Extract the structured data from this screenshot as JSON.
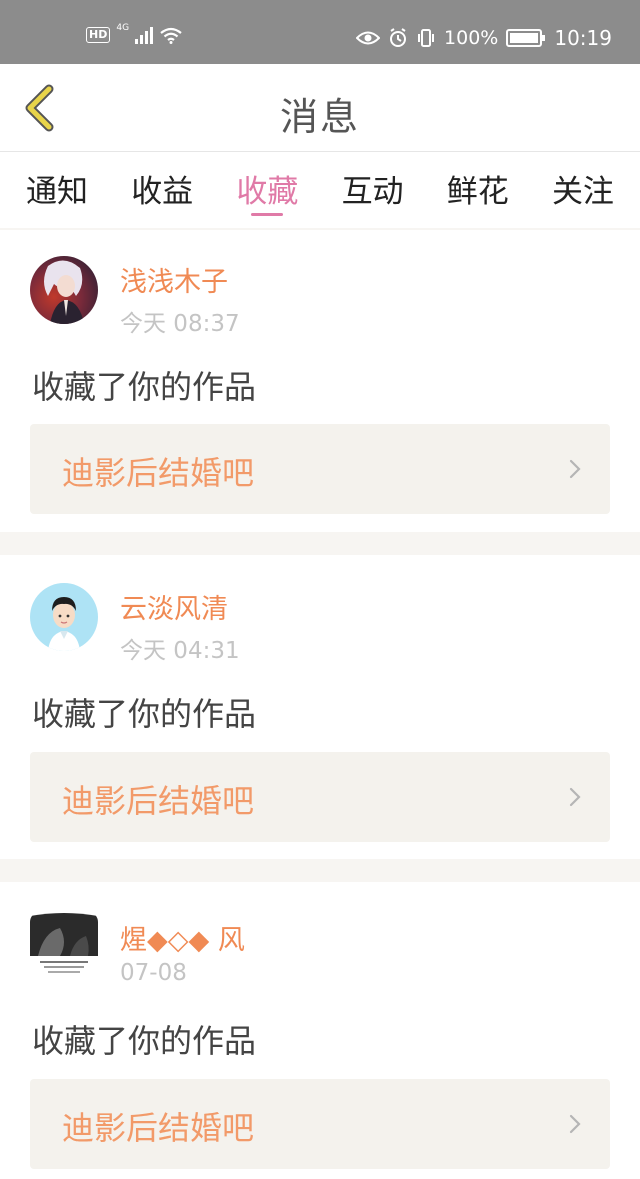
{
  "status_bar": {
    "hd": "HD",
    "network": "4G",
    "battery": "100%",
    "time": "10:19"
  },
  "header": {
    "title": "消息",
    "back_icon": "chevron-left-icon"
  },
  "tabs": [
    {
      "label": "通知",
      "active": false
    },
    {
      "label": "收益",
      "active": false
    },
    {
      "label": "收藏",
      "active": true
    },
    {
      "label": "互动",
      "active": false
    },
    {
      "label": "鲜花",
      "active": false
    },
    {
      "label": "关注",
      "active": false
    }
  ],
  "messages": [
    {
      "user": "浅浅木子",
      "time": "今天 08:37",
      "action": "收藏了你的作品",
      "work": "迪影后结婚吧"
    },
    {
      "user": "云淡风清",
      "time": "今天 04:31",
      "action": "收藏了你的作品",
      "work": "迪影后结婚吧"
    },
    {
      "user": "煋◆◇◆ 风",
      "time": "07-08",
      "action": "收藏了你的作品",
      "work": "迪影后结婚吧"
    }
  ],
  "colors": {
    "accent": "#e07aa7",
    "username": "#f08a54",
    "work_title": "#f29a69",
    "back_icon": "#e8d44a"
  }
}
